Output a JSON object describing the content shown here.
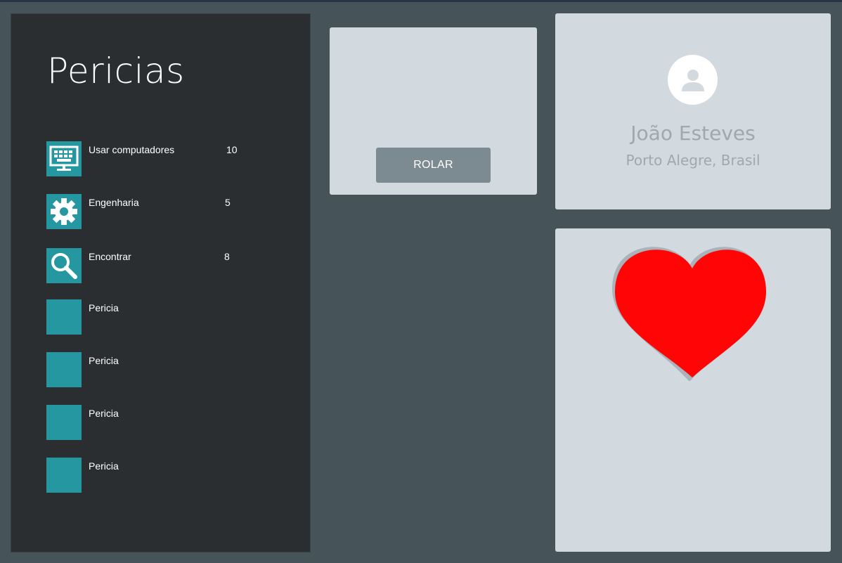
{
  "panel": {
    "title": "Pericias"
  },
  "skills": [
    {
      "label": "Usar computadores",
      "value": "10",
      "icon": "computer-icon"
    },
    {
      "label": "Engenharia",
      "value": "5",
      "icon": "gear-icon"
    },
    {
      "label": "Encontrar",
      "value": "8",
      "icon": "search-icon"
    },
    {
      "label": "Pericia",
      "value": "",
      "icon": ""
    },
    {
      "label": "Pericia",
      "value": "",
      "icon": ""
    },
    {
      "label": "Pericia",
      "value": "",
      "icon": ""
    },
    {
      "label": "Pericia",
      "value": "",
      "icon": ""
    }
  ],
  "roll": {
    "button_label": "ROLAR"
  },
  "profile": {
    "name": "João Esteves",
    "location": "Porto Alegre, Brasil",
    "avatar_icon": "person-icon"
  },
  "heart": {
    "icon": "heart-icon",
    "color": "#ff0505"
  },
  "colors": {
    "background": "#465359",
    "panel": "#2b2e30",
    "accent": "#2597a0",
    "card": "#d2d9df",
    "button": "#7c8a91"
  }
}
